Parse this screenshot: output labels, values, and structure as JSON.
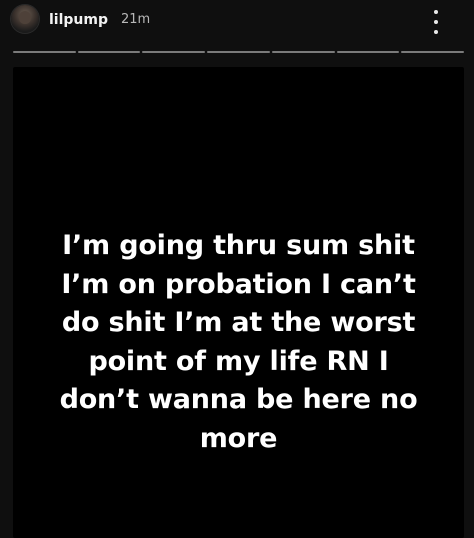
{
  "header": {
    "username": "lilpump",
    "time_ago": "21m",
    "avatar_icon": "profile-avatar",
    "more_icon": "more-vertical-icon"
  },
  "progress": {
    "segments": 7
  },
  "story": {
    "lines": [
      "I’m going thru sum shit",
      "I’m on probation I can’t",
      "do shit I’m at the worst",
      "point of my life RN  I",
      "don’t wanna be here no",
      "more"
    ]
  },
  "colors": {
    "background": "#000000",
    "text": "#ffffff",
    "progress": "#7a7a7a"
  }
}
